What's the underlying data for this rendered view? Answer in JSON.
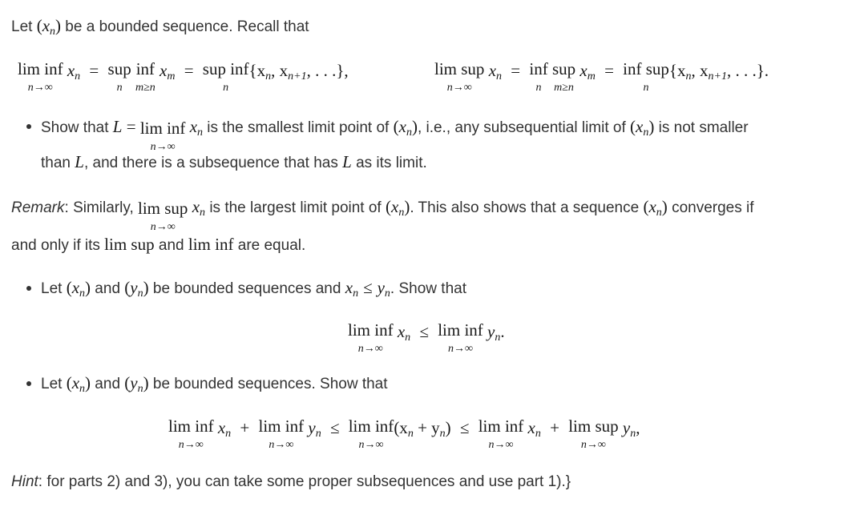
{
  "intro": {
    "prefix": "Let ",
    "seq": "(x",
    "seq_sub": "n",
    "seq_close": ")",
    "suffix": " be a bounded sequence. Recall that"
  },
  "definitions": {
    "liminf": {
      "lhs_op": "lim inf",
      "lhs_limit": "n→∞",
      "lhs_var": "x",
      "lhs_sub": "n",
      "eq1": "=",
      "mid_op1": "sup",
      "mid_op1_under": "n",
      "mid_op2": "inf",
      "mid_op2_under": "m≥n",
      "mid_var": "x",
      "mid_sub": "m",
      "eq2": "=",
      "rhs_op": "sup inf",
      "rhs_under": "n",
      "rhs_set": "{x",
      "rhs_set_sub1": "n",
      "rhs_set_mid": ", x",
      "rhs_set_sub2": "n+1",
      "rhs_set_end": ", . . .},"
    },
    "limsup": {
      "lhs_op": "lim sup",
      "lhs_limit": "n→∞",
      "lhs_var": "x",
      "lhs_sub": "n",
      "eq1": "=",
      "mid_op1": "inf",
      "mid_op1_under": "n",
      "mid_op2": "sup",
      "mid_op2_under": "m≥n",
      "mid_var": "x",
      "mid_sub": "m",
      "eq2": "=",
      "rhs_op": "inf sup",
      "rhs_under": "n",
      "rhs_set": "{x",
      "rhs_set_sub1": "n",
      "rhs_set_mid": ", x",
      "rhs_set_sub2": "n+1",
      "rhs_set_end": ", . . .}."
    }
  },
  "item1": {
    "t1": "Show that ",
    "L": "L",
    "eq": " = ",
    "op": "lim inf",
    "limit": "n→∞",
    "var": "x",
    "sub": "n",
    "t2": " is the smallest limit point of ",
    "t3": ", i.e., any subsequential limit of ",
    "t4": " is not smaller",
    "line2_a": "than ",
    "line2_b": ", and there is a subsequence that has ",
    "line2_c": " as its limit."
  },
  "remark": {
    "label": "Remark",
    "t1": ": Similarly, ",
    "op": "lim sup",
    "limit": "n→∞",
    "t2": " is the largest limit point of ",
    "t3": ". This also shows that a sequence ",
    "t4": " converges if",
    "line2_a": "and only if its ",
    "limsup": "lim sup",
    "line2_b": " and ",
    "liminf": "lim inf",
    "line2_c": " are equal."
  },
  "item2": {
    "t1": "Let ",
    "t2": " and ",
    "t3": " be bounded sequences and ",
    "leq": "≤",
    "t4": ". Show that",
    "display": {
      "op": "lim inf",
      "limit": "n→∞",
      "leq": "≤",
      "end": "."
    }
  },
  "item3": {
    "t1": "Let ",
    "t2": " and ",
    "t3": " be bounded sequences. Show that",
    "display": {
      "op_liminf": "lim inf",
      "op_limsup": "lim sup",
      "limit": "n→∞",
      "plus": "+",
      "leq": "≤",
      "sum_open": "(x",
      "sum_mid": " + y",
      "sum_close": ")",
      "end": ","
    }
  },
  "hint": {
    "label": "Hint",
    "text": ": for parts 2) and 3), you can take some proper subsequences and use part 1).}"
  },
  "symbols": {
    "x": "x",
    "y": "y",
    "n": "n",
    "L": "L",
    "open": "(",
    "close": ")"
  }
}
